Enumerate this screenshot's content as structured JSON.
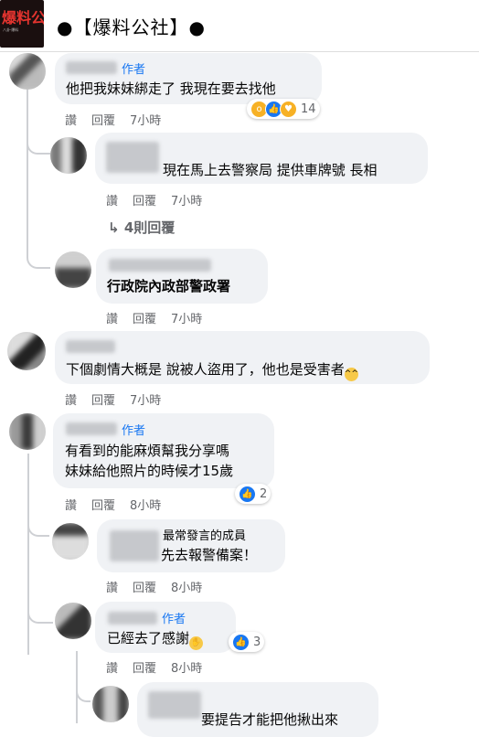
{
  "header": {
    "title": "●【爆料公社】●",
    "logo_text": "爆料公",
    "logo_sub": "八卦·爆料"
  },
  "labels": {
    "like": "讚",
    "reply": "回覆",
    "author": "作者"
  },
  "comments": [
    {
      "text": "他把我妹妹綁走了 我現在要去找他",
      "time": "7小時",
      "reaction_count": "14"
    },
    {
      "text": "現在馬上去警察局 提供車牌號 長相",
      "time": "7小時"
    },
    {
      "text": "行政院內政部警政署",
      "time": "7小時"
    },
    {
      "text": "下個劇情大概是 說被人盜用了，他也是受害者",
      "time": "7小時"
    },
    {
      "line1": "有看到的能麻煩幫我分享嗎",
      "line2": "妹妹給他照片的時候才15歲",
      "time": "8小時",
      "reaction_count": "2"
    },
    {
      "badge": "最常發言的成員",
      "text": "先去報警備案！",
      "time": "8小時"
    },
    {
      "text": "已經去了感謝",
      "time": "8小時",
      "reaction_count": "3"
    },
    {
      "text": "要提告才能把他揪出來"
    }
  ],
  "view_replies": "4則回覆",
  "colors": {
    "link": "#1877f2",
    "bubble": "#f0f2f5",
    "meta": "#65676b"
  }
}
